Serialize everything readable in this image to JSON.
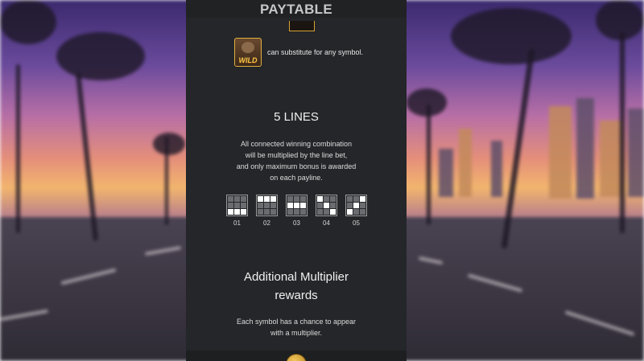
{
  "header": {
    "title": "PAYTABLE"
  },
  "wild": {
    "icon_label": "WILD",
    "description": "can substitute for any symbol."
  },
  "lines_section": {
    "heading": "5 LINES",
    "description_lines": [
      "All connected winning combination",
      "will be multiplied by the line bet,",
      "and only maximum bonus is awarded",
      "on each payline."
    ],
    "paylines": [
      {
        "number": "01",
        "pattern": [
          0,
          0,
          0,
          0,
          0,
          0,
          1,
          1,
          1
        ]
      },
      {
        "number": "02",
        "pattern": [
          1,
          1,
          1,
          0,
          0,
          0,
          0,
          0,
          0
        ]
      },
      {
        "number": "03",
        "pattern": [
          0,
          0,
          0,
          1,
          1,
          1,
          0,
          0,
          0
        ]
      },
      {
        "number": "04",
        "pattern": [
          1,
          0,
          0,
          0,
          1,
          0,
          0,
          0,
          1
        ]
      },
      {
        "number": "05",
        "pattern": [
          0,
          0,
          1,
          0,
          1,
          0,
          1,
          0,
          0
        ]
      }
    ]
  },
  "multiplier_section": {
    "heading_lines": [
      "Additional Multiplier",
      "rewards"
    ],
    "description_lines": [
      "Each symbol has a chance to appear",
      "with a multiplier."
    ]
  },
  "colors": {
    "panel_bg": "#242629",
    "header_text": "#c6c7c9",
    "accent_gold": "#d8a236"
  }
}
